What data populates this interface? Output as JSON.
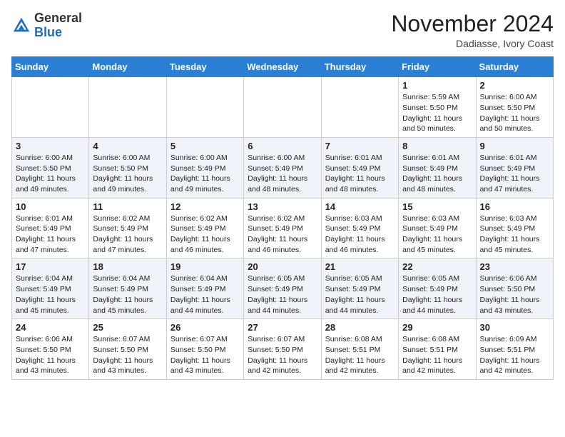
{
  "header": {
    "logo_line1": "General",
    "logo_line2": "Blue",
    "month_title": "November 2024",
    "location": "Dadiasse, Ivory Coast"
  },
  "days_of_week": [
    "Sunday",
    "Monday",
    "Tuesday",
    "Wednesday",
    "Thursday",
    "Friday",
    "Saturday"
  ],
  "weeks": [
    {
      "days": [
        {
          "num": "",
          "info": ""
        },
        {
          "num": "",
          "info": ""
        },
        {
          "num": "",
          "info": ""
        },
        {
          "num": "",
          "info": ""
        },
        {
          "num": "",
          "info": ""
        },
        {
          "num": "1",
          "info": "Sunrise: 5:59 AM\nSunset: 5:50 PM\nDaylight: 11 hours\nand 50 minutes."
        },
        {
          "num": "2",
          "info": "Sunrise: 6:00 AM\nSunset: 5:50 PM\nDaylight: 11 hours\nand 50 minutes."
        }
      ]
    },
    {
      "days": [
        {
          "num": "3",
          "info": "Sunrise: 6:00 AM\nSunset: 5:50 PM\nDaylight: 11 hours\nand 49 minutes."
        },
        {
          "num": "4",
          "info": "Sunrise: 6:00 AM\nSunset: 5:50 PM\nDaylight: 11 hours\nand 49 minutes."
        },
        {
          "num": "5",
          "info": "Sunrise: 6:00 AM\nSunset: 5:49 PM\nDaylight: 11 hours\nand 49 minutes."
        },
        {
          "num": "6",
          "info": "Sunrise: 6:00 AM\nSunset: 5:49 PM\nDaylight: 11 hours\nand 48 minutes."
        },
        {
          "num": "7",
          "info": "Sunrise: 6:01 AM\nSunset: 5:49 PM\nDaylight: 11 hours\nand 48 minutes."
        },
        {
          "num": "8",
          "info": "Sunrise: 6:01 AM\nSunset: 5:49 PM\nDaylight: 11 hours\nand 48 minutes."
        },
        {
          "num": "9",
          "info": "Sunrise: 6:01 AM\nSunset: 5:49 PM\nDaylight: 11 hours\nand 47 minutes."
        }
      ]
    },
    {
      "days": [
        {
          "num": "10",
          "info": "Sunrise: 6:01 AM\nSunset: 5:49 PM\nDaylight: 11 hours\nand 47 minutes."
        },
        {
          "num": "11",
          "info": "Sunrise: 6:02 AM\nSunset: 5:49 PM\nDaylight: 11 hours\nand 47 minutes."
        },
        {
          "num": "12",
          "info": "Sunrise: 6:02 AM\nSunset: 5:49 PM\nDaylight: 11 hours\nand 46 minutes."
        },
        {
          "num": "13",
          "info": "Sunrise: 6:02 AM\nSunset: 5:49 PM\nDaylight: 11 hours\nand 46 minutes."
        },
        {
          "num": "14",
          "info": "Sunrise: 6:03 AM\nSunset: 5:49 PM\nDaylight: 11 hours\nand 46 minutes."
        },
        {
          "num": "15",
          "info": "Sunrise: 6:03 AM\nSunset: 5:49 PM\nDaylight: 11 hours\nand 45 minutes."
        },
        {
          "num": "16",
          "info": "Sunrise: 6:03 AM\nSunset: 5:49 PM\nDaylight: 11 hours\nand 45 minutes."
        }
      ]
    },
    {
      "days": [
        {
          "num": "17",
          "info": "Sunrise: 6:04 AM\nSunset: 5:49 PM\nDaylight: 11 hours\nand 45 minutes."
        },
        {
          "num": "18",
          "info": "Sunrise: 6:04 AM\nSunset: 5:49 PM\nDaylight: 11 hours\nand 45 minutes."
        },
        {
          "num": "19",
          "info": "Sunrise: 6:04 AM\nSunset: 5:49 PM\nDaylight: 11 hours\nand 44 minutes."
        },
        {
          "num": "20",
          "info": "Sunrise: 6:05 AM\nSunset: 5:49 PM\nDaylight: 11 hours\nand 44 minutes."
        },
        {
          "num": "21",
          "info": "Sunrise: 6:05 AM\nSunset: 5:49 PM\nDaylight: 11 hours\nand 44 minutes."
        },
        {
          "num": "22",
          "info": "Sunrise: 6:05 AM\nSunset: 5:49 PM\nDaylight: 11 hours\nand 44 minutes."
        },
        {
          "num": "23",
          "info": "Sunrise: 6:06 AM\nSunset: 5:50 PM\nDaylight: 11 hours\nand 43 minutes."
        }
      ]
    },
    {
      "days": [
        {
          "num": "24",
          "info": "Sunrise: 6:06 AM\nSunset: 5:50 PM\nDaylight: 11 hours\nand 43 minutes."
        },
        {
          "num": "25",
          "info": "Sunrise: 6:07 AM\nSunset: 5:50 PM\nDaylight: 11 hours\nand 43 minutes."
        },
        {
          "num": "26",
          "info": "Sunrise: 6:07 AM\nSunset: 5:50 PM\nDaylight: 11 hours\nand 43 minutes."
        },
        {
          "num": "27",
          "info": "Sunrise: 6:07 AM\nSunset: 5:50 PM\nDaylight: 11 hours\nand 42 minutes."
        },
        {
          "num": "28",
          "info": "Sunrise: 6:08 AM\nSunset: 5:51 PM\nDaylight: 11 hours\nand 42 minutes."
        },
        {
          "num": "29",
          "info": "Sunrise: 6:08 AM\nSunset: 5:51 PM\nDaylight: 11 hours\nand 42 minutes."
        },
        {
          "num": "30",
          "info": "Sunrise: 6:09 AM\nSunset: 5:51 PM\nDaylight: 11 hours\nand 42 minutes."
        }
      ]
    }
  ]
}
